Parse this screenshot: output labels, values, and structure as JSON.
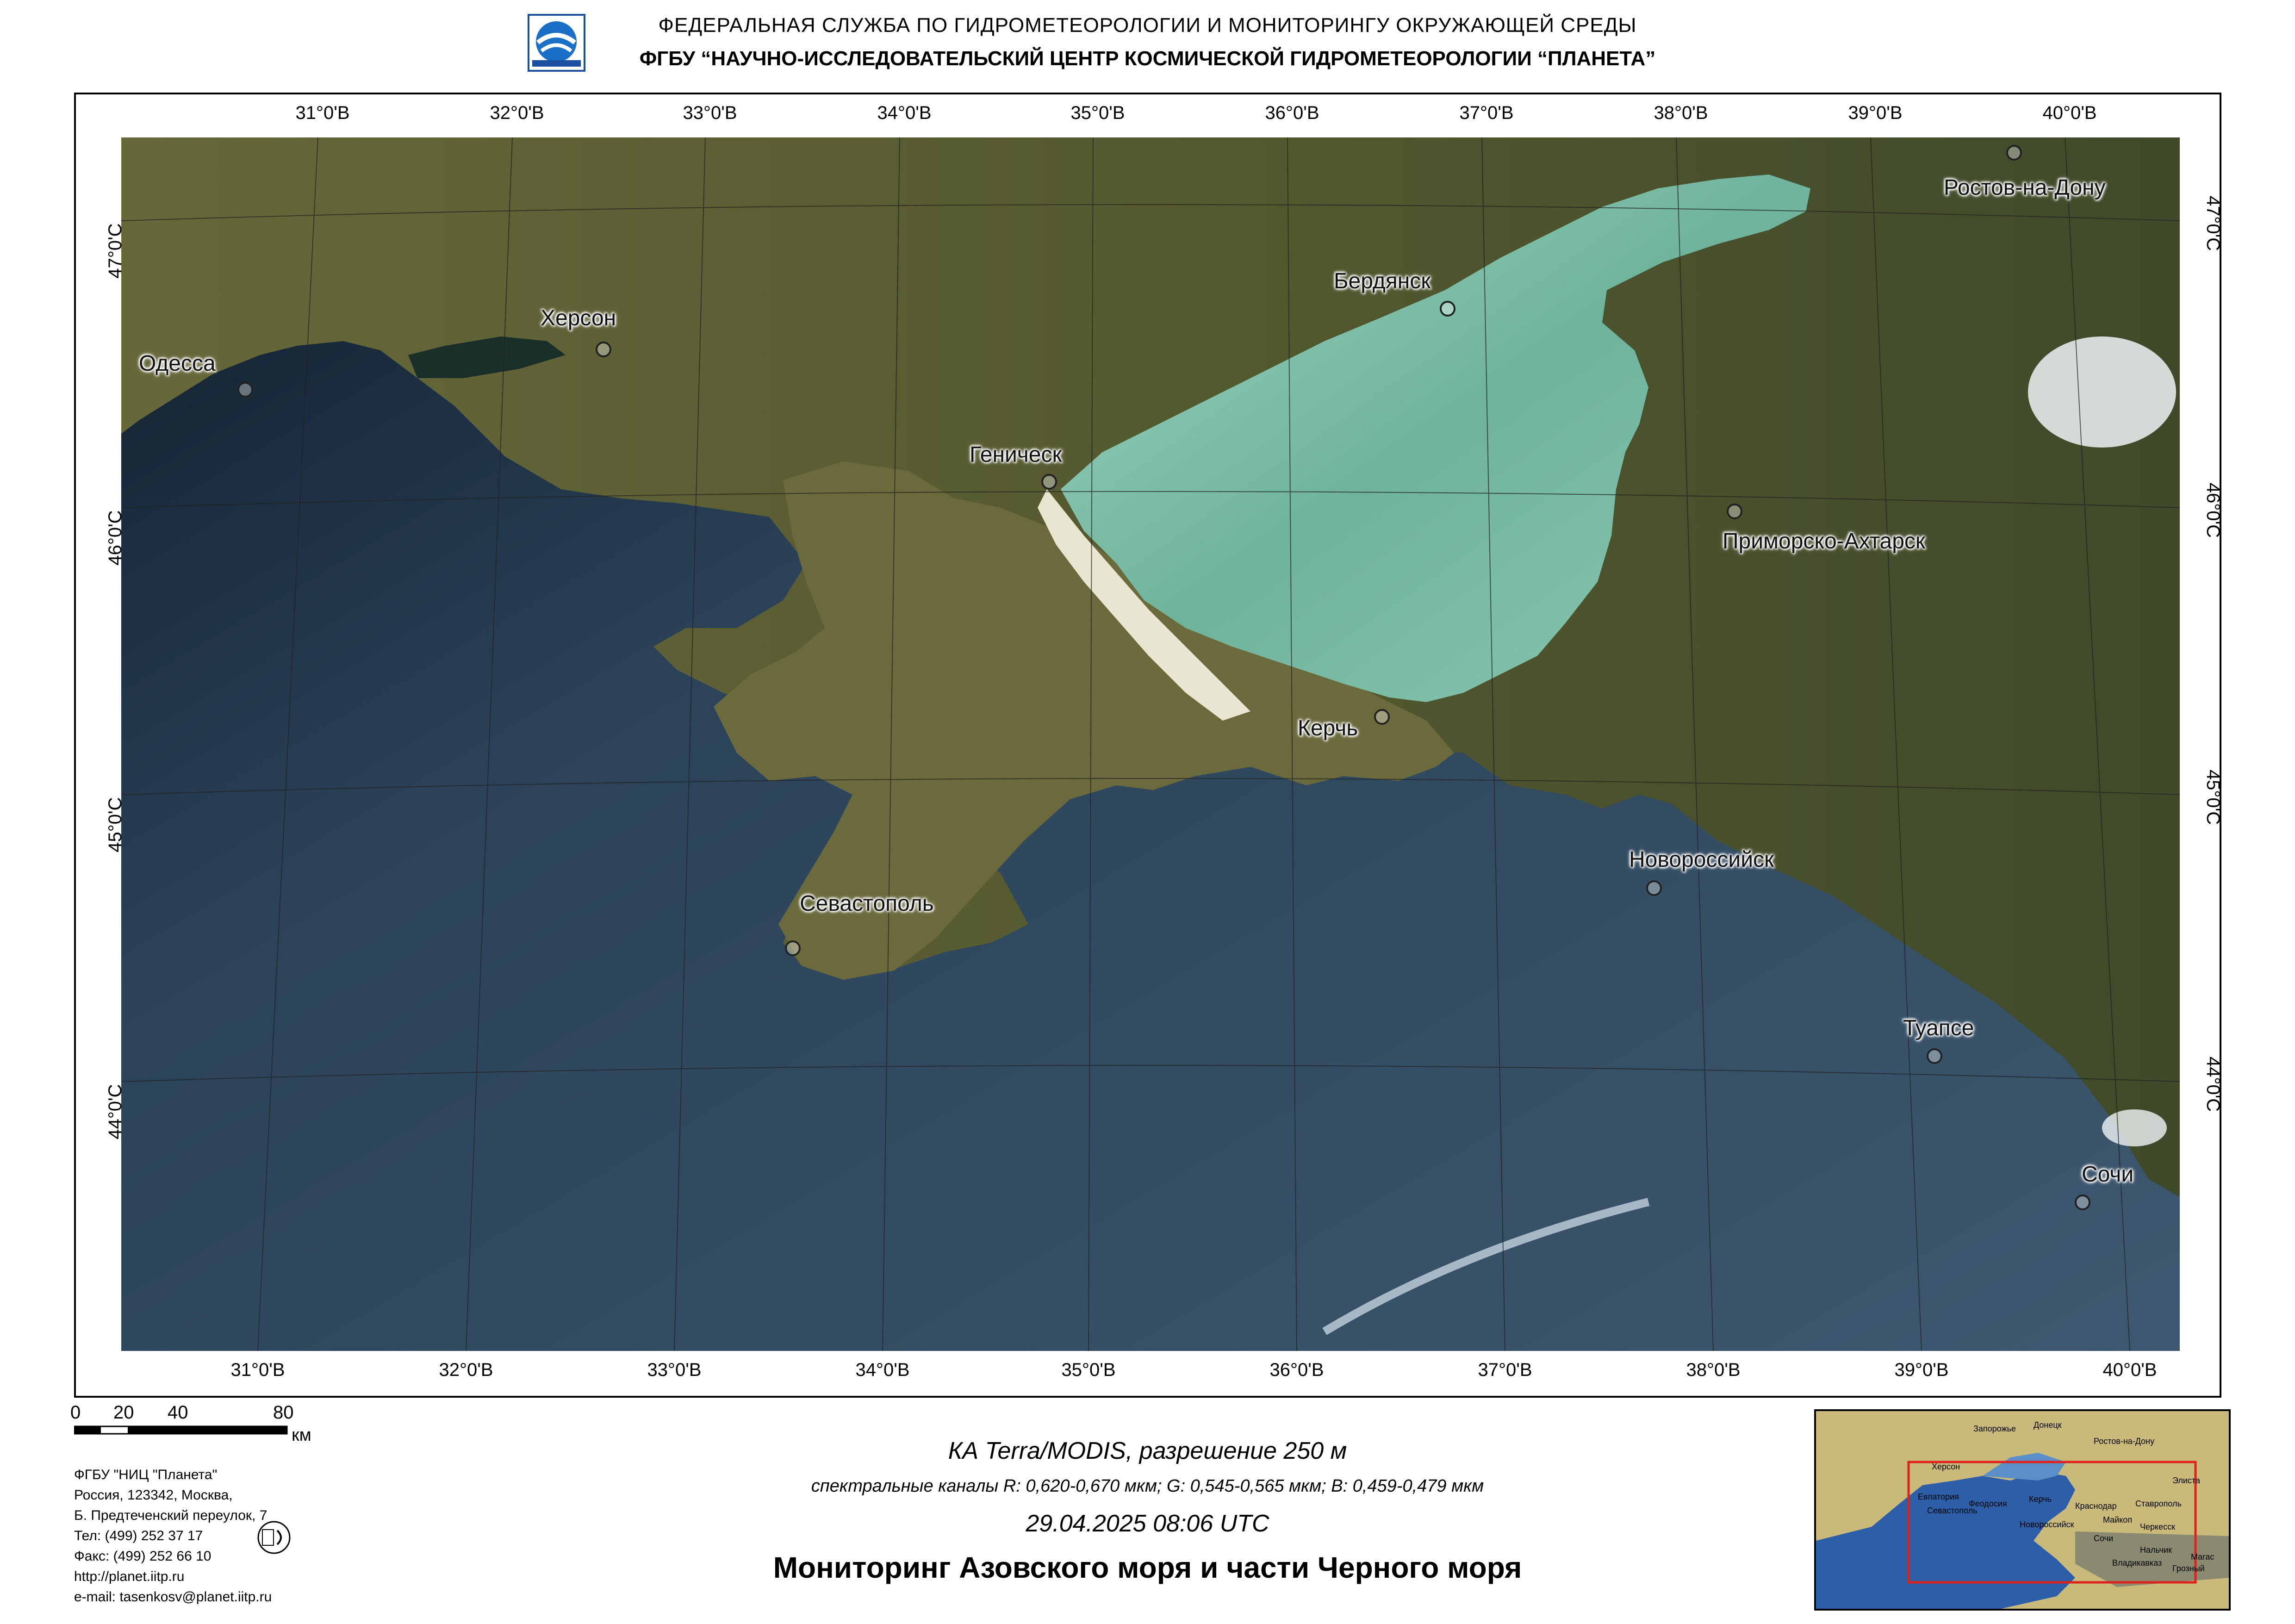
{
  "header": {
    "line1": "ФЕДЕРАЛЬНАЯ  СЛУЖБА  ПО ГИДРОМЕТЕОРОЛОГИИ И МОНИТОРИНГУ ОКРУЖАЮЩЕЙ СРЕДЫ",
    "line2": "ФГБУ “НАУЧНО-ИССЛЕДОВАТЕЛЬСКИЙ ЦЕНТР КОСМИЧЕСКОЙ ГИДРОМЕТЕОРОЛОГИИ “ПЛАНЕТА”",
    "logo_icon": "roshydromet-logo-icon"
  },
  "map": {
    "top_ticks": [
      "31°0'В",
      "32°0'В",
      "33°0'В",
      "34°0'В",
      "35°0'В",
      "36°0'В",
      "37°0'В",
      "38°0'В",
      "39°0'В",
      "40°0'В"
    ],
    "bottom_ticks": [
      "31°0'В",
      "32°0'В",
      "33°0'В",
      "34°0'В",
      "35°0'В",
      "36°0'В",
      "37°0'В",
      "38°0'В",
      "39°0'В",
      "40°0'В"
    ],
    "left_ticks": [
      "47°0'С",
      "46°0'С",
      "45°0'С",
      "44°0'С"
    ],
    "right_ticks": [
      "47°0'С",
      "46°0'С",
      "45°0'С",
      "44°0'С"
    ],
    "cities": [
      {
        "name": "Одесса"
      },
      {
        "name": "Херсон"
      },
      {
        "name": "Геническ"
      },
      {
        "name": "Бердянск"
      },
      {
        "name": "Ростов-на-Дону"
      },
      {
        "name": "Приморско-Ахтарск"
      },
      {
        "name": "Керчь"
      },
      {
        "name": "Новороссийск"
      },
      {
        "name": "Севастополь"
      },
      {
        "name": "Туапсе"
      },
      {
        "name": "Сочи"
      }
    ],
    "colors": {
      "sea": "#33485c",
      "azov_sea": "#7fbfa4",
      "land": "#5b5f34",
      "coastline": "#111111"
    }
  },
  "scale": {
    "labels": [
      "0",
      "20",
      "40",
      "80"
    ],
    "unit": "км"
  },
  "institution": {
    "lines": [
      "ФГБУ \"НИЦ \"Планета\"",
      "Россия, 123342,  Москва,",
      "Б. Предтеченский переулок, 7",
      "Тел: (499) 252 37 17",
      "Факс: (499) 252 66 10",
      "http://planet.iitp.ru",
      "e-mail: tasenkosv@planet.iitp.ru"
    ]
  },
  "caption": {
    "satellite": "КА Terra/MODIS, разрешение 250 м",
    "bands": "спектральные каналы R: 0,620-0,670 мкм; G: 0,545-0,565 мкм;  B: 0,459-0,479 мкм",
    "datetime": "29.04.2025   08:06 UTC",
    "title": "Мониторинг Азовского моря и части Черного моря"
  },
  "inset": {
    "labels": [
      "Запорожье",
      "Донецк",
      "Ростов-на-Дону",
      "Херсон",
      "Элиста",
      "Евпатория",
      "Керчь",
      "Севастополь",
      "Феодосия",
      "Краснодар",
      "Ставрополь",
      "Майкоп",
      "Новороссийск",
      "Черкесск",
      "Сочи",
      "Нальчик",
      "Владикавказ",
      "Грозный",
      "Магас"
    ]
  }
}
